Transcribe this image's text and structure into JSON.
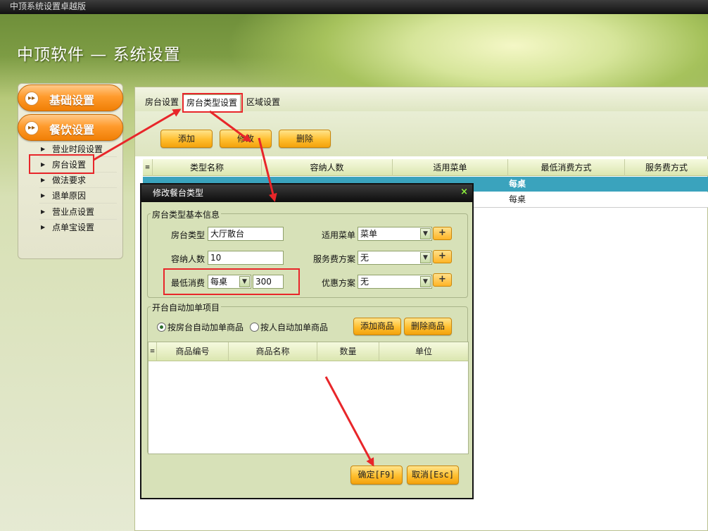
{
  "window": {
    "title": "中顶系统设置卓越版"
  },
  "app": {
    "title": "中顶软件 — 系统设置"
  },
  "sidebar": {
    "groups": [
      {
        "label": "基础设置"
      },
      {
        "label": "餐饮设置"
      }
    ],
    "items": [
      {
        "label": "营业时段设置"
      },
      {
        "label": "房台设置"
      },
      {
        "label": "做法要求"
      },
      {
        "label": "退单原因"
      },
      {
        "label": "营业点设置"
      },
      {
        "label": "点单宝设置"
      }
    ]
  },
  "tabs": [
    {
      "label": "房台设置"
    },
    {
      "label": "房台类型设置"
    },
    {
      "label": "区域设置"
    }
  ],
  "toolbar": {
    "add": "添加",
    "edit": "修改",
    "delete": "删除"
  },
  "grid": {
    "columns": [
      "类型名称",
      "容纳人数",
      "适用菜单",
      "最低消费方式",
      "服务费方式"
    ],
    "rows": [
      {
        "min_consume": "每桌"
      },
      {
        "min_consume": "每桌"
      }
    ]
  },
  "dialog": {
    "title": "修改餐台类型",
    "close": "×",
    "basic_group": "房台类型基本信息",
    "room_type_label": "房台类型",
    "room_type_value": "大厅散台",
    "capacity_label": "容纳人数",
    "capacity_value": "10",
    "min_consume_label": "最低消费",
    "min_consume_mode": "每桌",
    "min_consume_value": "300",
    "menu_label": "适用菜单",
    "menu_value": "菜单",
    "service_label": "服务费方案",
    "service_value": "无",
    "discount_label": "优惠方案",
    "discount_value": "无",
    "plus": "+",
    "auto_group": "开台自动加单项目",
    "radio_by_room": "按房台自动加单商品",
    "radio_by_person": "按人自动加单商品",
    "add_goods": "添加商品",
    "delete_goods": "删除商品",
    "goods_columns": [
      "商品编号",
      "商品名称",
      "数量",
      "单位"
    ],
    "ok": "确定[F9]",
    "cancel": "取消[Esc]"
  },
  "colors": {
    "accent": "#f39a1a",
    "highlight": "#e8262a",
    "selected_row": "#3aa3bd"
  }
}
